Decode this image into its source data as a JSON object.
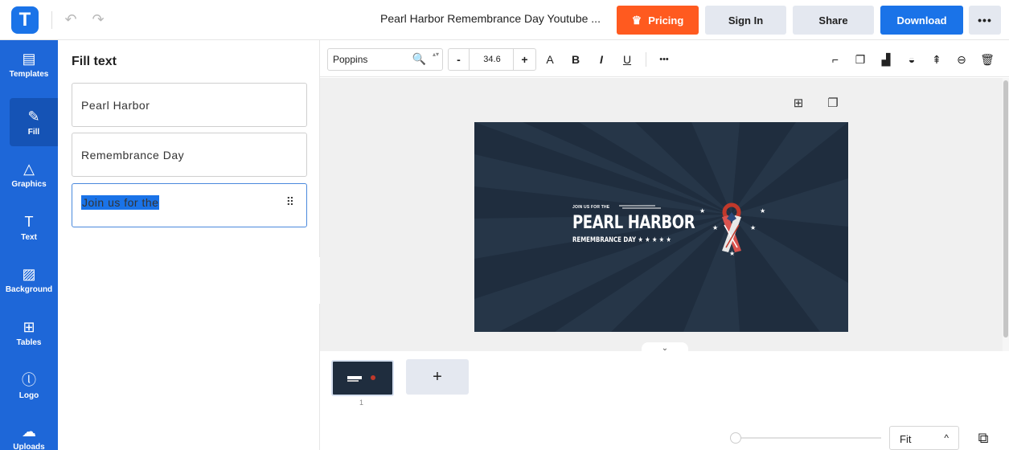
{
  "app": {
    "logo_letter": "T",
    "document_title": "Pearl Harbor Remembrance Day Youtube ...",
    "accent_color": "#1a73e8",
    "pricing_color": "#ff5a1f"
  },
  "header": {
    "undo_icon": "↶",
    "redo_icon": "↷",
    "pricing_label": "Pricing",
    "crown_icon": "♛",
    "signin_label": "Sign In",
    "share_label": "Share",
    "download_label": "Download",
    "more_label": "•••"
  },
  "sidebar": {
    "items": [
      {
        "icon": "▤",
        "label": "Templates"
      },
      {
        "icon": "✎",
        "label": "Fill"
      },
      {
        "icon": "△",
        "label": "Graphics"
      },
      {
        "icon": "T",
        "label": "Text"
      },
      {
        "icon": "▨",
        "label": "Background"
      },
      {
        "icon": "⊞",
        "label": "Tables"
      },
      {
        "icon": "ⓛ",
        "label": "Logo"
      },
      {
        "icon": "☁",
        "label": "Uploads"
      }
    ],
    "active_index": 1
  },
  "panel": {
    "title": "Fill text",
    "fields": [
      {
        "value": "Pearl Harbor"
      },
      {
        "value": "Remembrance Day"
      },
      {
        "value": "Join us for the"
      }
    ],
    "grip_icon": "⠿",
    "collapse_icon": "‹"
  },
  "toolbar": {
    "font_name": "Poppins",
    "search_icon": "🔍",
    "spin_icon": "▴▾",
    "minus": "-",
    "font_size": "34.6",
    "plus": "+",
    "case_icon": "A",
    "bold_icon": "B",
    "italic_icon": "I",
    "underline_icon": "U",
    "more_icon": "•••",
    "right_icons": [
      "⌐",
      "❐",
      "▟",
      "◒",
      "⇞",
      "⊖",
      "🗑"
    ]
  },
  "canvas": {
    "page_add_icon": "⊞",
    "page_copy_icon": "❐",
    "slide": {
      "join_text": "JOIN US FOR THE",
      "title": "PEARL HARBOR",
      "subtitle": "REMEMBRANCE DAY ★ ★ ★ ★ ★",
      "background_color": "#1f2d3e"
    },
    "expand_icon": "⌄"
  },
  "pages": {
    "thumbnail_number": "1",
    "add_page_icon": "+"
  },
  "zoom": {
    "value": "Fit",
    "caret": "^",
    "pages_icon": "⧉",
    "level": 0
  }
}
